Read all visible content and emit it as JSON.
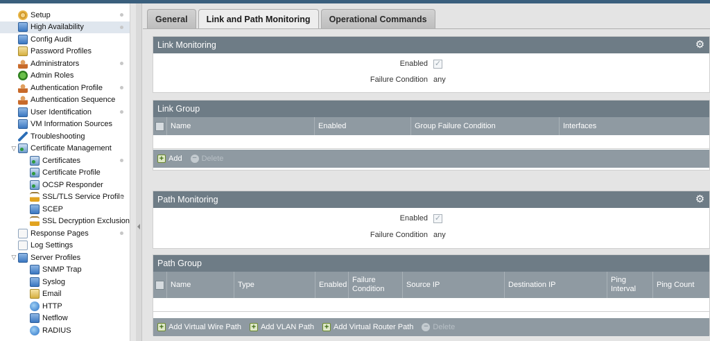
{
  "sidebar": {
    "items": [
      {
        "label": "Setup",
        "icon": "setup-icon",
        "dot": true
      },
      {
        "label": "High Availability",
        "icon": "high-availability-icon",
        "dot": true,
        "selected": true
      },
      {
        "label": "Config Audit",
        "icon": "config-audit-icon"
      },
      {
        "label": "Password Profiles",
        "icon": "password-profiles-icon"
      },
      {
        "label": "Administrators",
        "icon": "administrators-icon",
        "dot": true
      },
      {
        "label": "Admin Roles",
        "icon": "admin-roles-icon"
      },
      {
        "label": "Authentication Profile",
        "icon": "authentication-profile-icon",
        "dot": true
      },
      {
        "label": "Authentication Sequence",
        "icon": "authentication-sequence-icon"
      },
      {
        "label": "User Identification",
        "icon": "user-identification-icon",
        "dot": true
      },
      {
        "label": "VM Information Sources",
        "icon": "vm-information-sources-icon"
      },
      {
        "label": "Troubleshooting",
        "icon": "troubleshooting-icon"
      },
      {
        "label": "Certificate Management",
        "icon": "certificate-management-icon",
        "expanded": true
      },
      {
        "label": "Certificates",
        "icon": "certificates-icon",
        "dot": true,
        "child": true
      },
      {
        "label": "Certificate Profile",
        "icon": "certificate-profile-icon",
        "child": true
      },
      {
        "label": "OCSP Responder",
        "icon": "ocsp-responder-icon",
        "child": true
      },
      {
        "label": "SSL/TLS Service Profile",
        "icon": "ssl-tls-service-profile-icon",
        "dot": true,
        "child": true
      },
      {
        "label": "SCEP",
        "icon": "scep-icon",
        "child": true
      },
      {
        "label": "SSL Decryption Exclusion",
        "icon": "ssl-decryption-exclusion-icon",
        "child": true
      },
      {
        "label": "Response Pages",
        "icon": "response-pages-icon",
        "dot": true
      },
      {
        "label": "Log Settings",
        "icon": "log-settings-icon"
      },
      {
        "label": "Server Profiles",
        "icon": "server-profiles-icon",
        "expanded": true
      },
      {
        "label": "SNMP Trap",
        "icon": "snmp-trap-icon",
        "child": true
      },
      {
        "label": "Syslog",
        "icon": "syslog-icon",
        "child": true
      },
      {
        "label": "Email",
        "icon": "email-icon",
        "child": true
      },
      {
        "label": "HTTP",
        "icon": "http-icon",
        "child": true
      },
      {
        "label": "Netflow",
        "icon": "netflow-icon",
        "child": true
      },
      {
        "label": "RADIUS",
        "icon": "radius-icon",
        "child": true
      }
    ]
  },
  "tabs": [
    {
      "label": "General",
      "active": false
    },
    {
      "label": "Link and Path Monitoring",
      "active": true
    },
    {
      "label": "Operational Commands",
      "active": false
    }
  ],
  "link_monitoring": {
    "title": "Link Monitoring",
    "enabled_label": "Enabled",
    "enabled": true,
    "failure_condition_label": "Failure Condition",
    "failure_condition": "any"
  },
  "link_group": {
    "title": "Link Group",
    "columns": [
      "Name",
      "Enabled",
      "Group Failure Condition",
      "Interfaces"
    ],
    "rows": [],
    "add_label": "Add",
    "delete_label": "Delete"
  },
  "path_monitoring": {
    "title": "Path Monitoring",
    "enabled_label": "Enabled",
    "enabled": true,
    "failure_condition_label": "Failure Condition",
    "failure_condition": "any"
  },
  "path_group": {
    "title": "Path Group",
    "columns": [
      "Name",
      "Type",
      "Enabled",
      "Failure Condition",
      "Source IP",
      "Destination IP",
      "Ping Interval",
      "Ping Count"
    ],
    "rows": [],
    "add_virtual_wire_label": "Add Virtual Wire Path",
    "add_vlan_label": "Add VLAN Path",
    "add_virtual_router_label": "Add Virtual Router Path",
    "delete_label": "Delete"
  },
  "colors": {
    "panel_header": "#6e7c86",
    "grid_header": "#8f9aa2",
    "selected_row": "#dfe6ee",
    "top_strip": "#3a5f7d"
  }
}
